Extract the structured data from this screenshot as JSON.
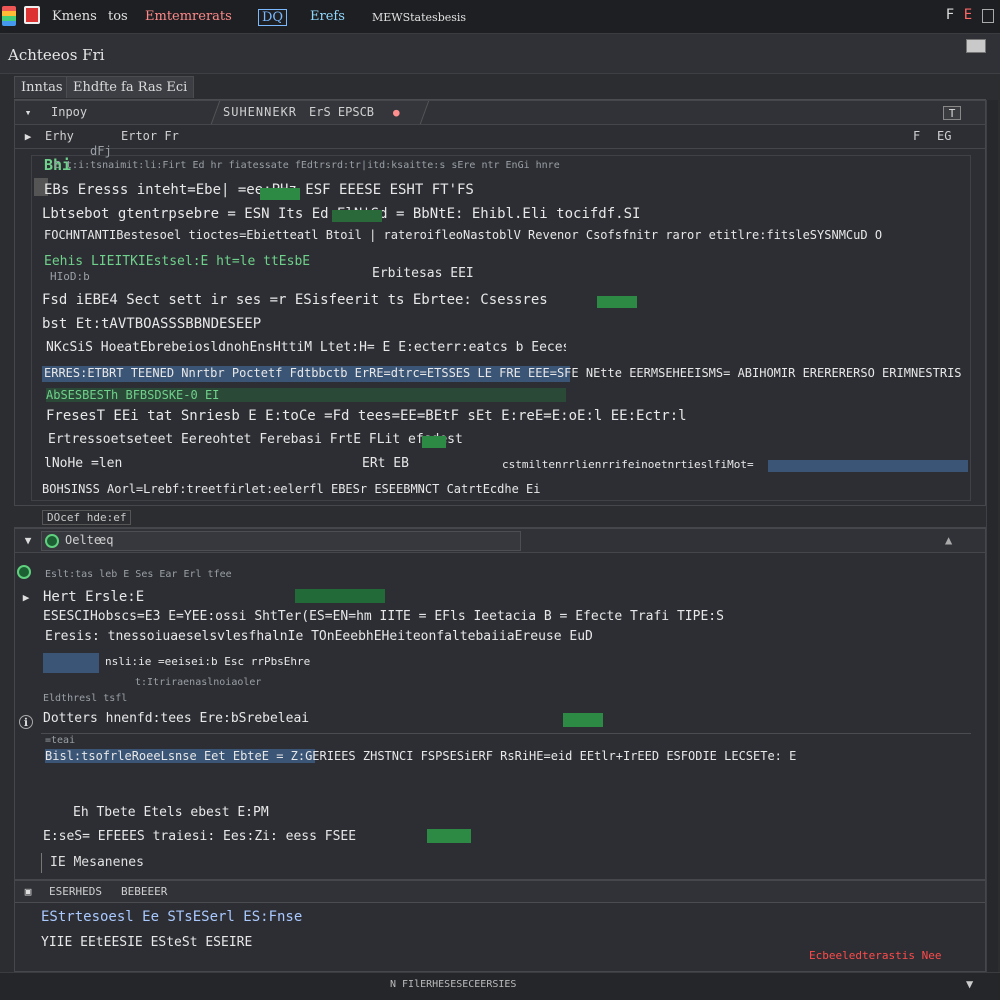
{
  "titlebar": {
    "menu": [
      {
        "label": "Kmens"
      },
      {
        "label": "tos"
      },
      {
        "label": "Emtemrerats"
      },
      {
        "label": "DQ"
      },
      {
        "label": "Erefs"
      },
      {
        "label": "MEWStatesbesis"
      }
    ],
    "controls": [
      "F",
      "E"
    ]
  },
  "subheader": {
    "title": "Achteeos Fri"
  },
  "tabs": [
    {
      "label": "Inntas"
    },
    {
      "label": "Ehdfte fa Ras Eci"
    }
  ],
  "top_panel": {
    "toolbar_label": "Inpoy",
    "header_title": "SUHENNEKR",
    "header_sub": "ErS EPSCB",
    "header_right_btn": "T",
    "sub_left": "Erhy",
    "sub_mid": "Ertor Fr",
    "sub_right": [
      "F",
      "EG"
    ],
    "block_label": "Bhi",
    "block_sub": "dFj",
    "lines": [
      "E t:i:tsnaimit:li:Firt Ed hr fiatessate fEdtrsrd:tr|itd:ksaitte:s sEre ntr EnGi hnre",
      "EBs Eresss inteht=Ebe|    =ee:PHz    ESF    EEESE    ESHT  FT'FS",
      "Lbtsebot gtentrpsebre = ESN Its Ed    ElN'Sd =    BbNtE: Ehibl.Eli tocifdf.SI",
      "FOCHNTANTIBestesoel tioctes=Ebietteatl Btoil | rateroifleoNastoblV  Revenor  Csofsfnitr raror etitlre:fitsleSYSNMCuD  O",
      "Eehis  LIEITKIEstsel:E ht=le ttEsbE",
      "HIoD:b",
      "Erbitesas EEI",
      "Fsd iEBE4 Sect sett ir    ses    =r ESisfeerit ts    Ebrtee:    Csessres",
      "bst Et:tAVTBOASSSBBNDESEEP",
      "NKcSiS HoeatEbrebeiosldnohEnsHttiM Ltet:H=    E E:ecterr:eatcs b  Eecess=ncalo",
      "ERRES:ETBRT  TEENED Nnrtbr Poctetf Fdtbbctb ErRE=dtrc=ETSSES  LE FRE EEE=SFE  NEtte EERMSEHEEISMS= ABIHOMIR ERERERERSO  ERIMNESTRIS  EB/ESEBB",
      "AbSESBESTh  BFBSDSKE-0 EI",
      "FresesT  EEi tat Snriesb E E:toCe   =Fd tees=EE=BEtF sEt  E:reE=E:oE:l     EE:Ectr:l",
      "Ertressoetseteet  Eereohtet  Ferebasi    FrtE    FLit  efsdest",
      "lNoHe =len",
      "ERt  EB",
      "cstmiltenrrlienrrifeinoetnrtieslfiMot=",
      "BOHSINSS  Aorl=Lrebf:treetfirlet:eelerfl  EBESr  ESEEBMNCT CatrtEcdhe Ei"
    ]
  },
  "mid_divider": {
    "label": "DOcef  hde:ef"
  },
  "bottom_panel": {
    "header_title": "Oelte",
    "header_sub": "eq",
    "lines": [
      "Eslt:tas leb E Ses Ear  Erl tfee",
      "Hert  Ersle:E",
      "ESESCIHobscs=E3  E=YEE:ossi  ShtTer(ES=EN=hm IITE = EFls  Ieetacia  B = Efecte  Trafi  TIPE:S",
      "Eresis:  tnessoiuaeselsvlesfhalnIe  TOnEeebhEHeiteonfaltebaiiaEreuse  EuD",
      "nsli:ie  =eeisei:b  Esc rrPbsEhre",
      "t:Itriraenaslnoiaoler",
      "Eldthresl tsfl",
      "Dotters  hnenfd:tees  Ere:bSrebeleai",
      "=teai",
      "Bisl:tsofrleRoeeLsnse  Eet  EbteE  =    Z:GERIEES  ZHSTNCI  FSPSESiERF  RsRiHE=eid  EEtlr+IrEED  ESFODIE  LECSETe: E",
      "Eh  Tbete  Etels  ebest  E:PM",
      "E:seS=  EFEEES  traiesi:  Ees:Zi:  eess  FSEE",
      "IE Mesanenes"
    ]
  },
  "output_panel": {
    "header": [
      "ESERHEDS",
      "BEBEEER"
    ],
    "lines": [
      "EStrtesoesl Ee  STsESerl  ES:Fnse",
      "YIIE  EEtEESIE  ESteSt  ESEIRE"
    ],
    "error_text": "Ecbeeledterastis Nee"
  },
  "statusbar": {
    "text": "N  FIlERHESESECEERSIES"
  },
  "colors": {
    "background": "#2b2d31",
    "accent_green": "#6fd18b",
    "accent_red": "#ff4b4b",
    "highlight_blue": "#3a4e6a"
  },
  "icons": [
    "app-icon",
    "folder-icon",
    "terminal-icon",
    "scroll-up-icon",
    "scroll-down-icon",
    "run-icon",
    "warning-icon"
  ]
}
